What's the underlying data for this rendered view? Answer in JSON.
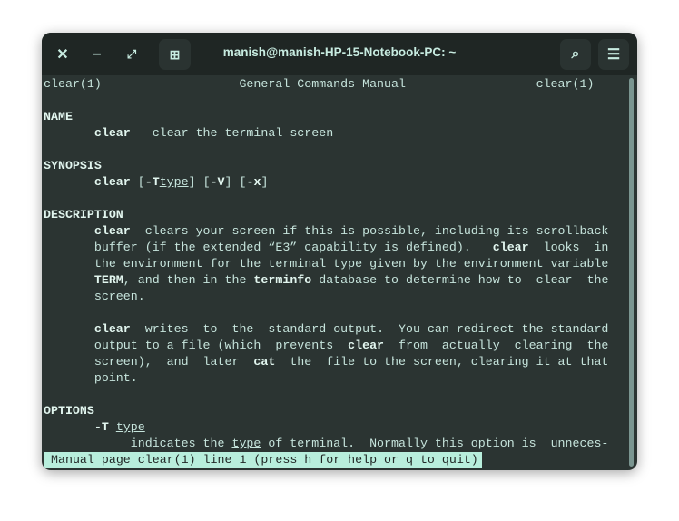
{
  "window": {
    "title": "manish@manish-HP-15-Notebook-PC: ~"
  },
  "icons": {
    "close": "close-icon",
    "minimize": "minimize-icon",
    "maximize": "maximize-icon",
    "new_tab": "new-tab-icon",
    "search": "search-icon",
    "menu": "hamburger-menu-icon"
  },
  "colors": {
    "header_bg": "#1f2624",
    "terminal_bg": "#2b3432",
    "text": "#c6e4dc",
    "status_bg": "#b8eedc"
  },
  "lines": [
    [
      [
        "clear(1)                   General Commands Manual                  clear(1)",
        ""
      ]
    ],
    [],
    [
      [
        "NAME",
        "b"
      ]
    ],
    [
      [
        "       ",
        ""
      ],
      [
        "clear",
        "b"
      ],
      [
        " - clear the terminal screen",
        ""
      ]
    ],
    [],
    [
      [
        "SYNOPSIS",
        "b"
      ]
    ],
    [
      [
        "       ",
        ""
      ],
      [
        "clear",
        "b"
      ],
      [
        " [",
        ""
      ],
      [
        "-T",
        "b"
      ],
      [
        "type",
        "u"
      ],
      [
        "] [",
        ""
      ],
      [
        "-V",
        "b"
      ],
      [
        "] [",
        ""
      ],
      [
        "-x",
        "b"
      ],
      [
        "]",
        ""
      ]
    ],
    [],
    [
      [
        "DESCRIPTION",
        "b"
      ]
    ],
    [
      [
        "       ",
        ""
      ],
      [
        "clear",
        "b"
      ],
      [
        "  clears your screen if this is possible, including its scrollback",
        ""
      ]
    ],
    [
      [
        "       buffer (if the extended “E3” capability is defined).   ",
        ""
      ],
      [
        "clear",
        "b"
      ],
      [
        "  looks  in",
        ""
      ]
    ],
    [
      [
        "       the environment for the terminal type given by the environment variable",
        ""
      ]
    ],
    [
      [
        "       ",
        ""
      ],
      [
        "TERM",
        "b"
      ],
      [
        ", and then in the ",
        ""
      ],
      [
        "terminfo",
        "b"
      ],
      [
        " database to determine how to  clear  the",
        ""
      ]
    ],
    [
      [
        "       screen.",
        ""
      ]
    ],
    [],
    [
      [
        "       ",
        ""
      ],
      [
        "clear",
        "b"
      ],
      [
        "  writes  to  the  standard output.  You can redirect the standard",
        ""
      ]
    ],
    [
      [
        "       output to a file (which  prevents  ",
        ""
      ],
      [
        "clear",
        "b"
      ],
      [
        "  from  actually  clearing  the",
        ""
      ]
    ],
    [
      [
        "       screen),  and  later  ",
        ""
      ],
      [
        "cat",
        "b"
      ],
      [
        "  the  file to the screen, clearing it at that",
        ""
      ]
    ],
    [
      [
        "       point.",
        ""
      ]
    ],
    [],
    [
      [
        "OPTIONS",
        "b"
      ]
    ],
    [
      [
        "       ",
        ""
      ],
      [
        "-T",
        "b"
      ],
      [
        " ",
        ""
      ],
      [
        "type",
        "u"
      ]
    ],
    [
      [
        "            indicates the ",
        ""
      ],
      [
        "type",
        "u"
      ],
      [
        " of terminal.  Normally this option is  unneces-",
        ""
      ]
    ]
  ],
  "status": "Manual page clear(1) line 1 (press h for help or q to quit)"
}
